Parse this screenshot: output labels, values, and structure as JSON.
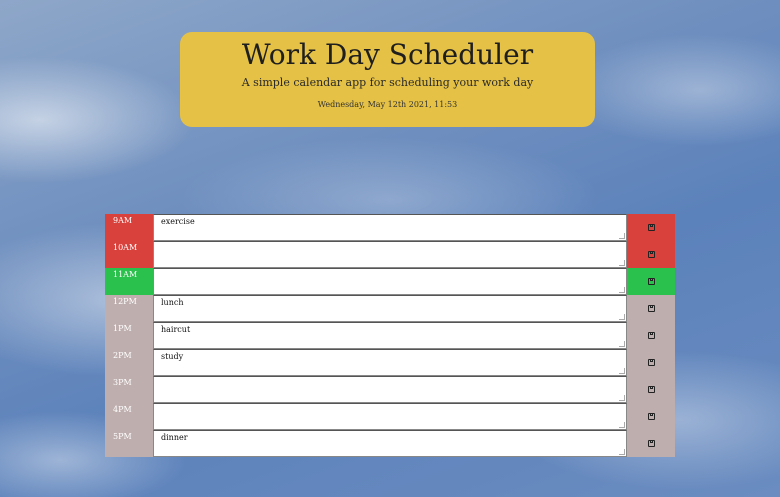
{
  "header": {
    "title": "Work Day Scheduler",
    "subtitle": "A simple calendar app for scheduling your work day",
    "current_date": "Wednesday, May 12th 2021, 11:53"
  },
  "colors": {
    "past": "#d9413c",
    "present": "#2bc14d",
    "future": "#bfaeae",
    "jumbotron": "#e5c145"
  },
  "timeblocks": [
    {
      "hour": "9AM",
      "text": "exercise",
      "status": "past",
      "save_icon": "floppy-disk-icon"
    },
    {
      "hour": "10AM",
      "text": "",
      "status": "past",
      "save_icon": "floppy-disk-icon"
    },
    {
      "hour": "11AM",
      "text": "",
      "status": "present",
      "save_icon": "floppy-disk-icon"
    },
    {
      "hour": "12PM",
      "text": "lunch",
      "status": "future",
      "save_icon": "floppy-disk-icon"
    },
    {
      "hour": "1PM",
      "text": "haircut",
      "status": "future",
      "save_icon": "floppy-disk-icon"
    },
    {
      "hour": "2PM",
      "text": "study",
      "status": "future",
      "save_icon": "floppy-disk-icon"
    },
    {
      "hour": "3PM",
      "text": "",
      "status": "future",
      "save_icon": "floppy-disk-icon"
    },
    {
      "hour": "4PM",
      "text": "",
      "status": "future",
      "save_icon": "floppy-disk-icon"
    },
    {
      "hour": "5PM",
      "text": "dinner",
      "status": "future",
      "save_icon": "floppy-disk-icon"
    }
  ]
}
